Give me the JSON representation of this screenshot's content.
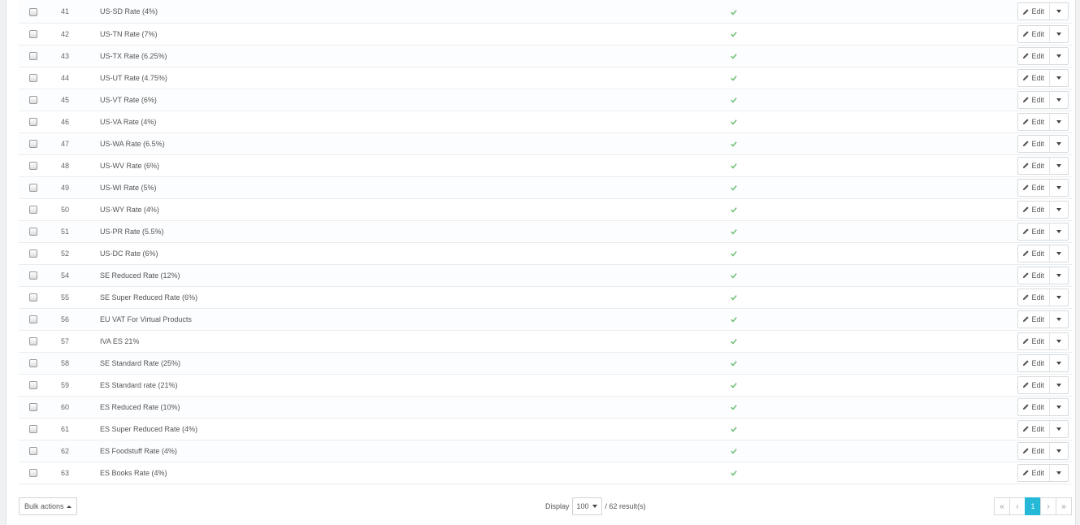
{
  "rows": [
    {
      "id": "41",
      "name": "US-SD Rate (4%)"
    },
    {
      "id": "42",
      "name": "US-TN Rate (7%)"
    },
    {
      "id": "43",
      "name": "US-TX Rate (6.25%)"
    },
    {
      "id": "44",
      "name": "US-UT Rate (4.75%)"
    },
    {
      "id": "45",
      "name": "US-VT Rate (6%)"
    },
    {
      "id": "46",
      "name": "US-VA Rate (4%)"
    },
    {
      "id": "47",
      "name": "US-WA Rate (6.5%)"
    },
    {
      "id": "48",
      "name": "US-WV Rate (6%)"
    },
    {
      "id": "49",
      "name": "US-WI Rate (5%)"
    },
    {
      "id": "50",
      "name": "US-WY Rate (4%)"
    },
    {
      "id": "51",
      "name": "US-PR Rate (5.5%)"
    },
    {
      "id": "52",
      "name": "US-DC Rate (6%)"
    },
    {
      "id": "54",
      "name": "SE Reduced Rate (12%)"
    },
    {
      "id": "55",
      "name": "SE Super Reduced Rate (6%)"
    },
    {
      "id": "56",
      "name": "EU VAT For Virtual Products"
    },
    {
      "id": "57",
      "name": "IVA ES 21%"
    },
    {
      "id": "58",
      "name": "SE Standard Rate (25%)"
    },
    {
      "id": "59",
      "name": "ES Standard rate (21%)"
    },
    {
      "id": "60",
      "name": "ES Reduced Rate (10%)"
    },
    {
      "id": "61",
      "name": "ES Super Reduced Rate (4%)"
    },
    {
      "id": "62",
      "name": "ES Foodstuff Rate (4%)"
    },
    {
      "id": "63",
      "name": "ES Books Rate (4%)"
    }
  ],
  "row_actions": {
    "edit_label": "Edit",
    "edit_icon": "pencil-icon",
    "toggle_icon": "caret-down-icon",
    "enabled_icon": "checkmark-icon"
  },
  "footer": {
    "bulk_actions_label": "Bulk actions",
    "display_label": "Display",
    "per_page": "100",
    "results_text": "/ 62 result(s)",
    "pagination": {
      "first": "«",
      "prev": "‹",
      "current": "1",
      "next": "›",
      "last": "»"
    }
  },
  "colors": {
    "accent": "#25b9d7",
    "enabled_check": "#72c279"
  }
}
